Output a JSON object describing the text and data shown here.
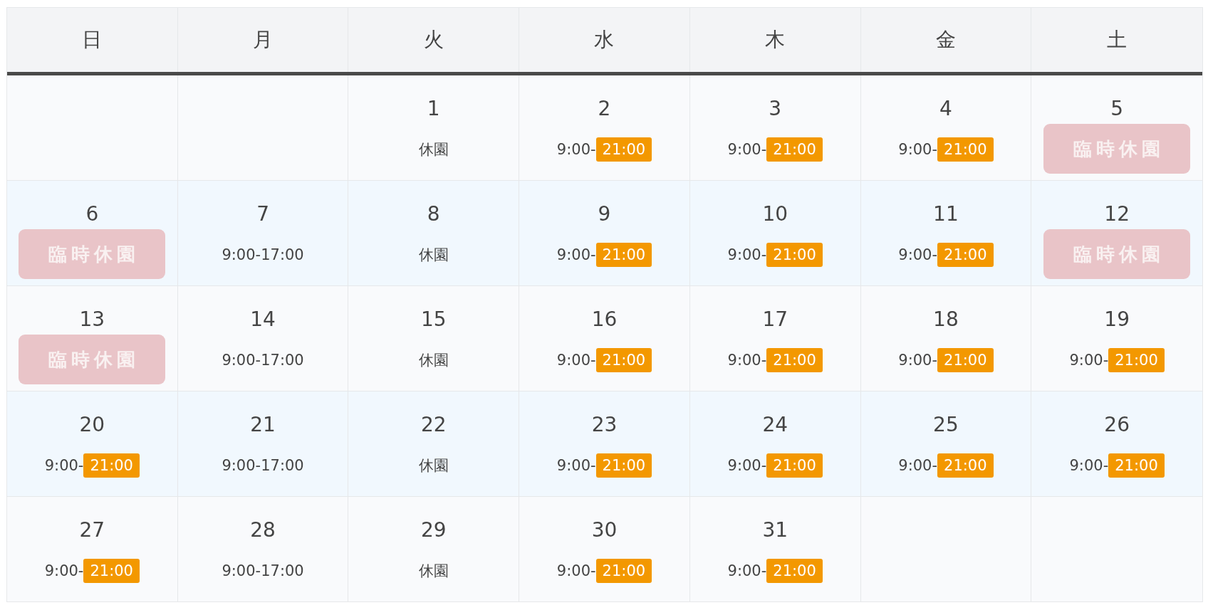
{
  "weekdays": [
    "日",
    "月",
    "火",
    "水",
    "木",
    "金",
    "土"
  ],
  "weeks": [
    {
      "cells": [
        {
          "kind": "empty"
        },
        {
          "kind": "empty"
        },
        {
          "kind": "closed",
          "date": "1",
          "note": "休園"
        },
        {
          "kind": "late",
          "date": "2",
          "open": "9:00-",
          "close": "21:00"
        },
        {
          "kind": "late",
          "date": "3",
          "open": "9:00-",
          "close": "21:00"
        },
        {
          "kind": "late",
          "date": "4",
          "open": "9:00-",
          "close": "21:00"
        },
        {
          "kind": "special",
          "date": "5",
          "label": "臨時休園"
        }
      ]
    },
    {
      "cells": [
        {
          "kind": "special",
          "date": "6",
          "label": "臨時休園"
        },
        {
          "kind": "hours",
          "date": "7",
          "hours": "9:00-17:00"
        },
        {
          "kind": "closed",
          "date": "8",
          "note": "休園"
        },
        {
          "kind": "late",
          "date": "9",
          "open": "9:00-",
          "close": "21:00"
        },
        {
          "kind": "late",
          "date": "10",
          "open": "9:00-",
          "close": "21:00"
        },
        {
          "kind": "late",
          "date": "11",
          "open": "9:00-",
          "close": "21:00"
        },
        {
          "kind": "special",
          "date": "12",
          "label": "臨時休園"
        }
      ]
    },
    {
      "cells": [
        {
          "kind": "special",
          "date": "13",
          "label": "臨時休園"
        },
        {
          "kind": "hours",
          "date": "14",
          "hours": "9:00-17:00"
        },
        {
          "kind": "closed",
          "date": "15",
          "note": "休園"
        },
        {
          "kind": "late",
          "date": "16",
          "open": "9:00-",
          "close": "21:00"
        },
        {
          "kind": "late",
          "date": "17",
          "open": "9:00-",
          "close": "21:00"
        },
        {
          "kind": "late",
          "date": "18",
          "open": "9:00-",
          "close": "21:00"
        },
        {
          "kind": "late",
          "date": "19",
          "open": "9:00-",
          "close": "21:00"
        }
      ]
    },
    {
      "cells": [
        {
          "kind": "late",
          "date": "20",
          "open": "9:00-",
          "close": "21:00"
        },
        {
          "kind": "hours",
          "date": "21",
          "hours": "9:00-17:00"
        },
        {
          "kind": "closed",
          "date": "22",
          "note": "休園"
        },
        {
          "kind": "late",
          "date": "23",
          "open": "9:00-",
          "close": "21:00"
        },
        {
          "kind": "late",
          "date": "24",
          "open": "9:00-",
          "close": "21:00"
        },
        {
          "kind": "late",
          "date": "25",
          "open": "9:00-",
          "close": "21:00"
        },
        {
          "kind": "late",
          "date": "26",
          "open": "9:00-",
          "close": "21:00"
        }
      ]
    },
    {
      "cells": [
        {
          "kind": "late",
          "date": "27",
          "open": "9:00-",
          "close": "21:00"
        },
        {
          "kind": "hours",
          "date": "28",
          "hours": "9:00-17:00"
        },
        {
          "kind": "closed",
          "date": "29",
          "note": "休園"
        },
        {
          "kind": "late",
          "date": "30",
          "open": "9:00-",
          "close": "21:00"
        },
        {
          "kind": "late",
          "date": "31",
          "open": "9:00-",
          "close": "21:00"
        },
        {
          "kind": "empty"
        },
        {
          "kind": "empty"
        }
      ]
    }
  ]
}
